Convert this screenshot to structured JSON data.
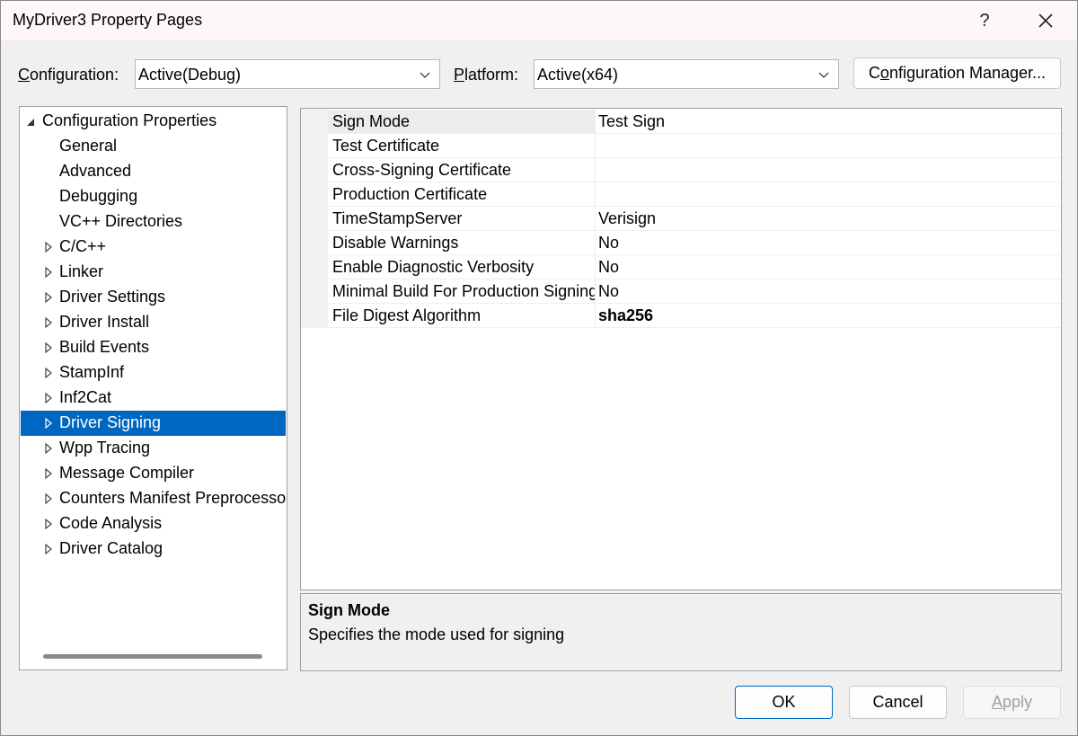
{
  "window": {
    "title": "MyDriver3 Property Pages",
    "help_label": "?"
  },
  "toolbar": {
    "configuration_label_pre": "",
    "configuration_label_key": "C",
    "configuration_label_post": "onfiguration:",
    "configuration_value": "Active(Debug)",
    "platform_label_key": "P",
    "platform_label_post": "latform:",
    "platform_value": "Active(x64)",
    "config_manager_pre": "C",
    "config_manager_key": "o",
    "config_manager_post": "nfiguration Manager..."
  },
  "tree": {
    "root": "Configuration Properties",
    "items": [
      {
        "label": "General",
        "expandable": false
      },
      {
        "label": "Advanced",
        "expandable": false
      },
      {
        "label": "Debugging",
        "expandable": false
      },
      {
        "label": "VC++ Directories",
        "expandable": false
      },
      {
        "label": "C/C++",
        "expandable": true
      },
      {
        "label": "Linker",
        "expandable": true
      },
      {
        "label": "Driver Settings",
        "expandable": true
      },
      {
        "label": "Driver Install",
        "expandable": true
      },
      {
        "label": "Build Events",
        "expandable": true
      },
      {
        "label": "StampInf",
        "expandable": true
      },
      {
        "label": "Inf2Cat",
        "expandable": true
      },
      {
        "label": "Driver Signing",
        "expandable": true,
        "selected": true
      },
      {
        "label": "Wpp Tracing",
        "expandable": true
      },
      {
        "label": "Message Compiler",
        "expandable": true
      },
      {
        "label": "Counters Manifest Preprocessor",
        "expandable": true
      },
      {
        "label": "Code Analysis",
        "expandable": true
      },
      {
        "label": "Driver Catalog",
        "expandable": true
      }
    ]
  },
  "properties": [
    {
      "name": "Sign Mode",
      "value": "Test Sign"
    },
    {
      "name": "Test Certificate",
      "value": ""
    },
    {
      "name": "Cross-Signing Certificate",
      "value": ""
    },
    {
      "name": "Production Certificate",
      "value": ""
    },
    {
      "name": "TimeStampServer",
      "value": "Verisign"
    },
    {
      "name": "Disable Warnings",
      "value": "No"
    },
    {
      "name": "Enable Diagnostic Verbosity",
      "value": "No"
    },
    {
      "name": "Minimal Build For Production Signing",
      "value": "No"
    },
    {
      "name": "File Digest Algorithm",
      "value": "sha256"
    }
  ],
  "description": {
    "title": "Sign Mode",
    "text": "Specifies the mode used for signing"
  },
  "buttons": {
    "ok": "OK",
    "cancel": "Cancel",
    "apply_key": "A",
    "apply_post": "pply"
  },
  "colors": {
    "selection": "#0067c0",
    "window_bg": "#f0f0f0",
    "disabled_text": "#a0a0a0"
  },
  "icons": {
    "close": "close-icon",
    "help": "help-icon",
    "dropdown": "chevron-down-icon",
    "tree_expanded": "tree-expanded-icon",
    "tree_collapsed": "tree-collapsed-icon"
  }
}
